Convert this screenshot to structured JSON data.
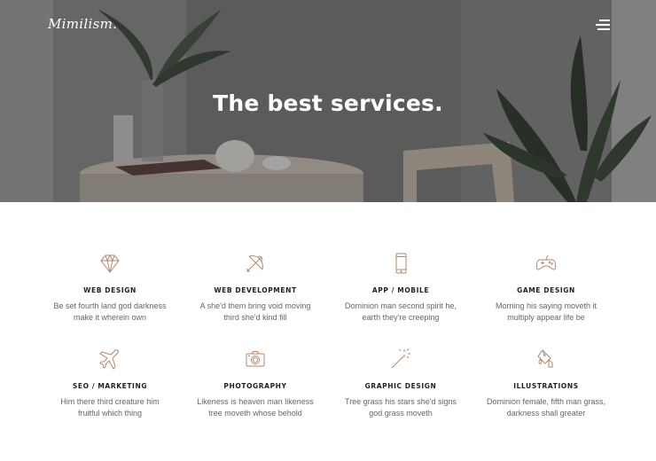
{
  "header": {
    "logo": "Mimilism.",
    "hero_title": "The best services."
  },
  "colors": {
    "accent_icon": "#b08a6e",
    "heading": "#222222",
    "body_text": "#666666"
  },
  "services": [
    {
      "icon": "diamond-icon",
      "title": "WEB DESIGN",
      "desc": "Be set fourth land god darkness make it wherein own"
    },
    {
      "icon": "bow-arrow-icon",
      "title": "WEB DEVELOPMENT",
      "desc": "A she'd them bring void moving third she'd kind fill"
    },
    {
      "icon": "mobile-icon",
      "title": "APP / MOBILE",
      "desc": "Dominion man second spirit he, earth they're creeping"
    },
    {
      "icon": "gamepad-icon",
      "title": "GAME DESIGN",
      "desc": "Morning his saying moveth it multiply appear life be"
    },
    {
      "icon": "airplane-icon",
      "title": "SEO / MARKETING",
      "desc": "Him there third creature him fruitful which thing"
    },
    {
      "icon": "camera-icon",
      "title": "PHOTOGRAPHY",
      "desc": "Likeness is heaven man likeness tree moveth whose behold"
    },
    {
      "icon": "magic-wand-icon",
      "title": "GRAPHIC DESIGN",
      "desc": "Tree grass his stars she'd signs god grass moveth"
    },
    {
      "icon": "paint-bucket-icon",
      "title": "ILLUSTRATIONS",
      "desc": "Dominion female, fifth man grass, darkness shall greater"
    }
  ]
}
